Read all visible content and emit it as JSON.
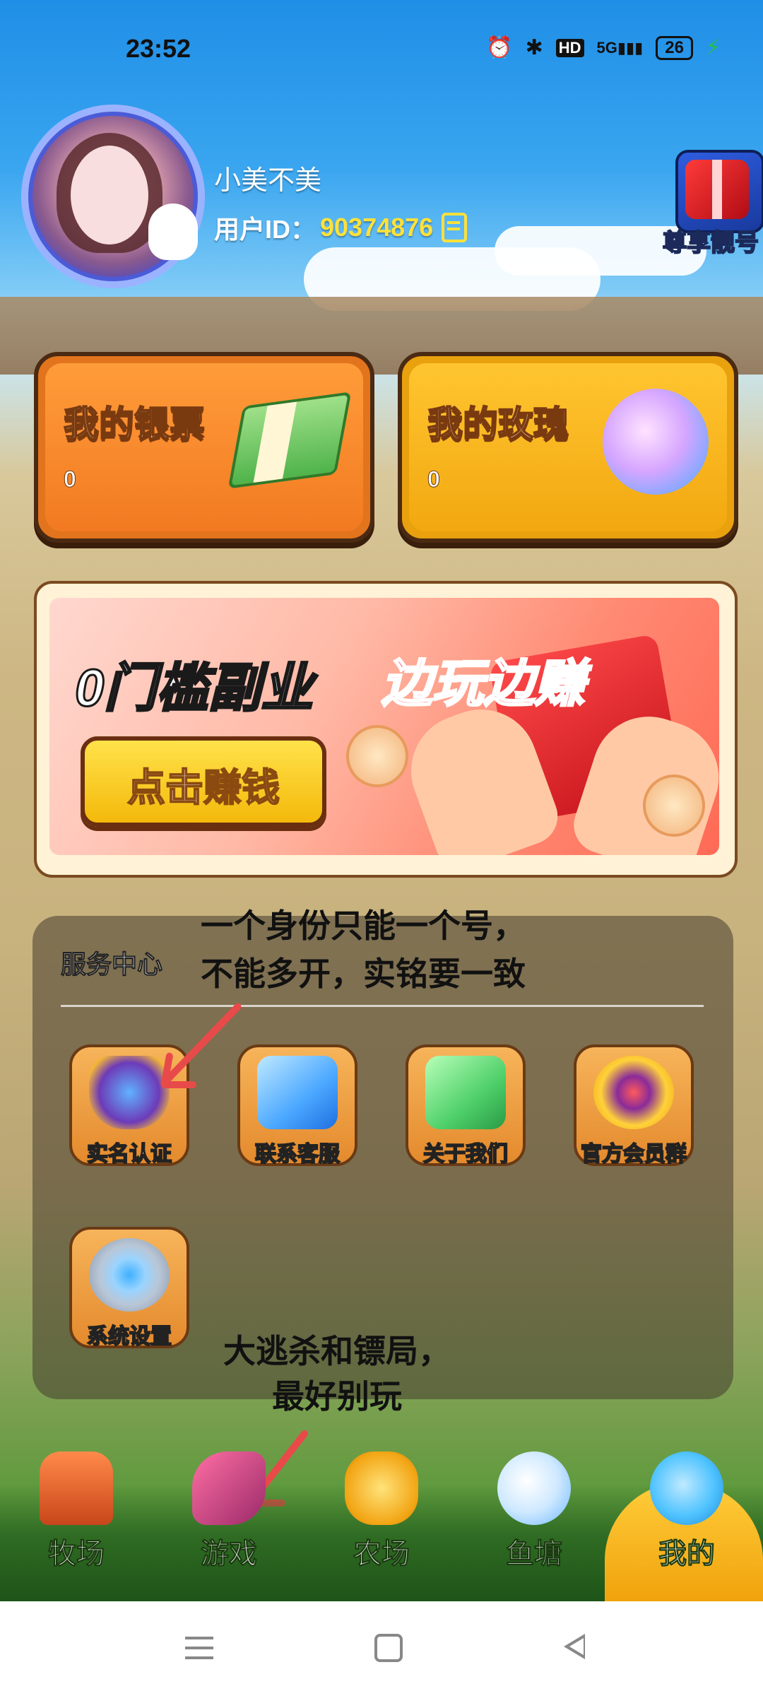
{
  "status_bar": {
    "time": "23:52",
    "network": "5G",
    "hd": "HD",
    "battery": "26"
  },
  "profile": {
    "username": "小美不美",
    "user_id_label": "用户ID：",
    "user_id": "90374876"
  },
  "vip": {
    "label": "尊享靓号"
  },
  "cards": [
    {
      "title": "我的银票",
      "value": "0"
    },
    {
      "title": "我的玫瑰",
      "value": "0"
    }
  ],
  "banner": {
    "title_left": "0门槛副业",
    "title_right": "边玩边赚",
    "button": "点击赚钱"
  },
  "service": {
    "title": "服务中心",
    "items": [
      {
        "label": "实名认证",
        "icon": "shield-icon"
      },
      {
        "label": "联系客服",
        "icon": "customer-service-icon"
      },
      {
        "label": "关于我们",
        "icon": "about-icon"
      },
      {
        "label": "官方会员群",
        "icon": "trophy-icon"
      },
      {
        "label": "系统设置",
        "icon": "gear-icon"
      }
    ]
  },
  "annotations": {
    "note1_line1": "一个身份只能一个号，",
    "note1_line2": "不能多开，实铭要一致",
    "note2_line1": "大逃杀和镖局，",
    "note2_line2": "最好别玩"
  },
  "nav": [
    {
      "label": "牧场",
      "icon": "ranch-icon"
    },
    {
      "label": "游戏",
      "icon": "game-icon"
    },
    {
      "label": "农场",
      "icon": "farm-icon"
    },
    {
      "label": "鱼塘",
      "icon": "fish-pond-icon"
    },
    {
      "label": "我的",
      "icon": "profile-icon",
      "active": true
    }
  ],
  "colors": {
    "accent_yellow": "#ffe13a",
    "annotation_arrow": "#e84a4a",
    "nav_active": "#f0a20c"
  }
}
